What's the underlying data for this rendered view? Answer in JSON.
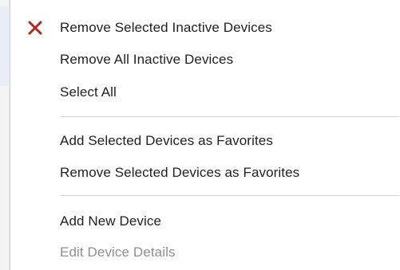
{
  "menu": {
    "items": [
      {
        "label": "Remove Selected Inactive Devices",
        "icon": "close-icon",
        "enabled": true
      },
      {
        "label": "Remove All Inactive Devices",
        "enabled": true
      },
      {
        "label": "Select All",
        "enabled": true
      },
      {
        "label": "Add Selected Devices as Favorites",
        "enabled": true
      },
      {
        "label": "Remove Selected Devices as Favorites",
        "enabled": true
      },
      {
        "label": "Add New Device",
        "enabled": true
      },
      {
        "label": "Edit Device Details",
        "enabled": false
      }
    ]
  },
  "colors": {
    "icon_red": "#b0281e",
    "text": "#1f1f1f",
    "disabled_text": "#8e8e8e",
    "separator": "#d3d3d3"
  }
}
